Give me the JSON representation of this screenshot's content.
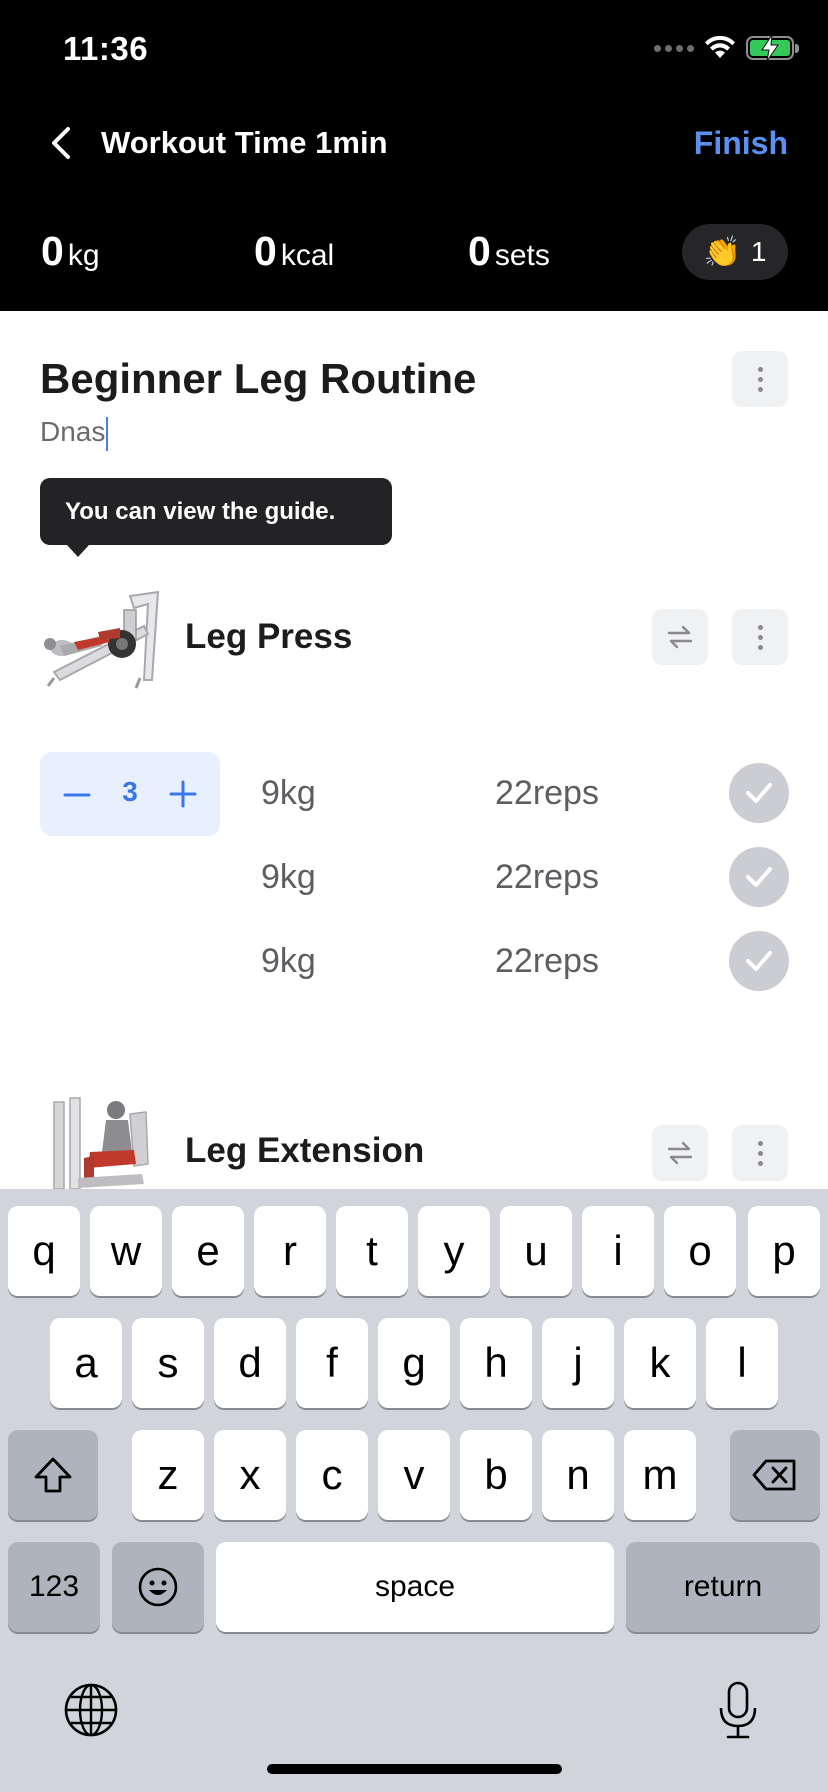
{
  "status_bar": {
    "time": "11:36"
  },
  "nav": {
    "title": "Workout Time 1min",
    "finish_label": "Finish"
  },
  "stats": {
    "weight": {
      "value": "0",
      "unit": "kg"
    },
    "calories": {
      "value": "0",
      "unit": "kcal"
    },
    "sets": {
      "value": "0",
      "unit": "sets"
    },
    "claps": "1"
  },
  "routine": {
    "title": "Beginner Leg Routine",
    "note": "Dnas"
  },
  "tooltip": {
    "text": "You can view the guide."
  },
  "exercises": [
    {
      "name": "Leg Press",
      "set_count": "3",
      "sets": [
        {
          "weight": "9kg",
          "reps": "22reps"
        },
        {
          "weight": "9kg",
          "reps": "22reps"
        },
        {
          "weight": "9kg",
          "reps": "22reps"
        }
      ]
    },
    {
      "name": "Leg Extension"
    }
  ],
  "keyboard": {
    "row1": [
      "q",
      "w",
      "e",
      "r",
      "t",
      "y",
      "u",
      "i",
      "o",
      "p"
    ],
    "row2": [
      "a",
      "s",
      "d",
      "f",
      "g",
      "h",
      "j",
      "k",
      "l"
    ],
    "row3": [
      "z",
      "x",
      "c",
      "v",
      "b",
      "n",
      "m"
    ],
    "numbers_label": "123",
    "space_label": "space",
    "return_label": "return"
  },
  "colors": {
    "header_bg": "#000000",
    "accent": "#5b8ff0",
    "stepper_bg": "#e8f0fd",
    "keyboard_bg": "#d1d4da"
  },
  "icons": [
    "back-chevron-icon",
    "wifi-icon",
    "battery-charging-icon",
    "clap-icon",
    "more-vertical-icon",
    "swap-icon",
    "minus-icon",
    "plus-icon",
    "check-icon",
    "shift-icon",
    "delete-icon",
    "emoji-icon",
    "globe-icon",
    "microphone-icon"
  ]
}
